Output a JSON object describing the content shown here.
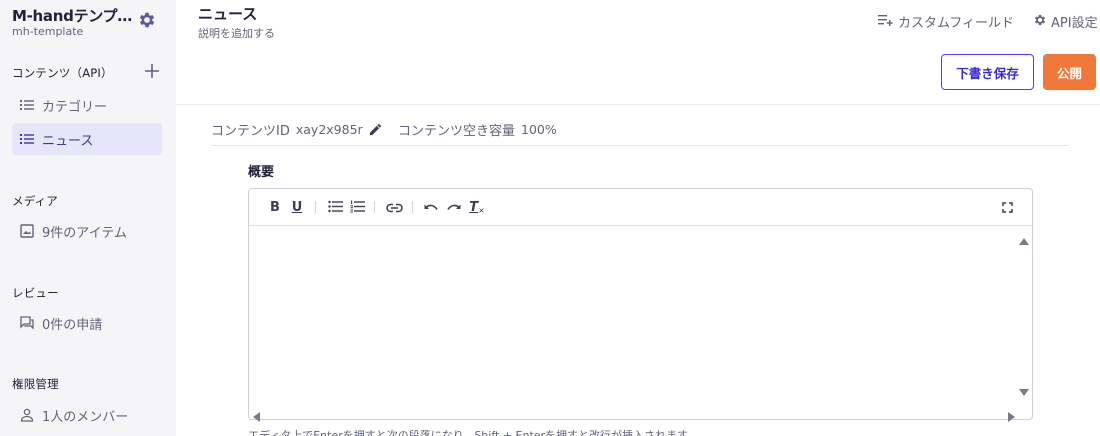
{
  "sidebar": {
    "app_title": "M-handテンプ…",
    "app_sub": "mh-template",
    "sections": {
      "content": "コンテンツ（API）",
      "media": "メディア",
      "review": "レビュー",
      "permissions": "権限管理"
    },
    "items": [
      {
        "label": "カテゴリー",
        "icon": "list-icon"
      },
      {
        "label": "ニュース",
        "icon": "list-icon"
      },
      {
        "label": "9件のアイテム",
        "icon": "image-icon"
      },
      {
        "label": "0件の申請",
        "icon": "comments-icon"
      },
      {
        "label": "1人のメンバー",
        "icon": "person-icon"
      }
    ]
  },
  "header": {
    "title": "ニュース",
    "description": "説明を追加する",
    "custom_fields": "カスタムフィールド",
    "api_settings": "API設定",
    "draft_button": "下書き保存",
    "publish_button": "公開"
  },
  "meta": {
    "content_id_label": "コンテンツID",
    "content_id_value": "xay2x985r",
    "capacity_label": "コンテンツ空き容量",
    "capacity_value": "100%"
  },
  "editor": {
    "field_label": "概要",
    "toolbar": {
      "bold": "B",
      "underline": "U",
      "clear": "T"
    },
    "hint": "エディタ上でEnterを押すと次の段落になり、Shift + Enterを押すと改行が挿入されます。"
  },
  "colors": {
    "accent": "#563bff",
    "publish": "#f2773a",
    "sidebar_bg": "#f5f5f8",
    "active_bg": "#e7e5f9"
  }
}
